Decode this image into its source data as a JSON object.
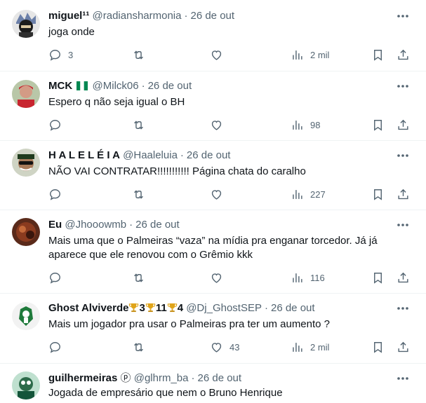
{
  "tweets": [
    {
      "name": "miguel¹¹",
      "handle": "@radiansharmonia",
      "dot": "·",
      "date": "26 de out",
      "text": "joga onde",
      "replies": "3",
      "retweets": "",
      "likes": "",
      "views": "2 mil"
    },
    {
      "name": "MCK",
      "handle": "@Milck06",
      "dot": "·",
      "date": "26 de out",
      "text": "Espero q não seja igual o BH",
      "replies": "",
      "retweets": "",
      "likes": "",
      "views": "98"
    },
    {
      "name": "H A L E L É I A",
      "handle": "@Haaleluia",
      "dot": "·",
      "date": "26 de out",
      "text": "NÃO VAI CONTRATAR!!!!!!!!!!! Página chata do caralho",
      "replies": "",
      "retweets": "",
      "likes": "",
      "views": "227"
    },
    {
      "name": "Eu",
      "handle": "@Jhooowmb",
      "dot": "·",
      "date": "26 de out",
      "text": "Mais uma que o Palmeiras “vaza” na mídia pra enganar torcedor. Já já aparece que ele renovou com o Grêmio kkk",
      "replies": "",
      "retweets": "",
      "likes": "",
      "views": "116"
    },
    {
      "name": "Ghost Alviverde",
      "name_suffix_1": "3",
      "name_suffix_2": "11",
      "name_suffix_3": "4",
      "handle": "@Dj_GhostSEP",
      "dot": "·",
      "date": "26 de out",
      "text": "Mais um jogador pra usar o Palmeiras pra ter um aumento ?",
      "replies": "",
      "retweets": "",
      "likes": "43",
      "views": "2 mil"
    },
    {
      "name": "guilhermeiras",
      "name_suffix": "ⓟ",
      "handle": "@glhrm_ba",
      "dot": "·",
      "date": "26 de out",
      "text": "Jogada de empresário que nem o Bruno Henrique"
    }
  ],
  "colors": {
    "text": "#0f1419",
    "secondary": "#536471",
    "divider": "#eff3f4",
    "flag_green": "#008751"
  },
  "icons": [
    "reply-icon",
    "retweet-icon",
    "like-icon",
    "views-icon",
    "bookmark-icon",
    "share-icon",
    "more-icon"
  ]
}
